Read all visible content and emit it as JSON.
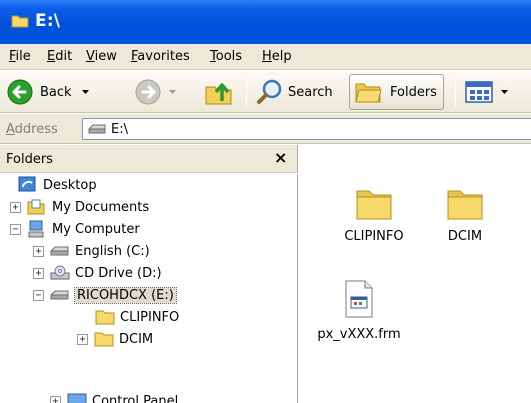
{
  "window": {
    "title": "E:\\"
  },
  "menu": [
    "File",
    "Edit",
    "View",
    "Favorites",
    "Tools",
    "Help"
  ],
  "toolbar": {
    "back_label": "Back",
    "search_label": "Search",
    "folders_label": "Folders"
  },
  "address": {
    "label": "Address",
    "value": "E:\\"
  },
  "folders_pane": {
    "title": "Folders",
    "close_glyph": "×",
    "tree": [
      {
        "label": "Desktop"
      },
      {
        "label": "My Documents",
        "expander": "+"
      },
      {
        "label": "My Computer",
        "expander": "−"
      },
      {
        "label": "English (C:)",
        "expander": "+"
      },
      {
        "label": "CD Drive (D:)",
        "expander": "+"
      },
      {
        "label": "RICOHDCX (E:)",
        "expander": "−",
        "selected": true
      },
      {
        "label": "CLIPINFO"
      },
      {
        "label": "DCIM",
        "expander": "+"
      },
      {
        "label": "Control Panel",
        "expander": "+"
      }
    ]
  },
  "files": [
    {
      "name": "CLIPINFO",
      "type": "folder"
    },
    {
      "name": "DCIM",
      "type": "folder"
    },
    {
      "name": "px_vXXX.frm",
      "type": "file"
    }
  ],
  "colors": {
    "titlebar": "#0a5ee9",
    "folder": "#f7d96b",
    "chrome": "#ece9d8"
  }
}
